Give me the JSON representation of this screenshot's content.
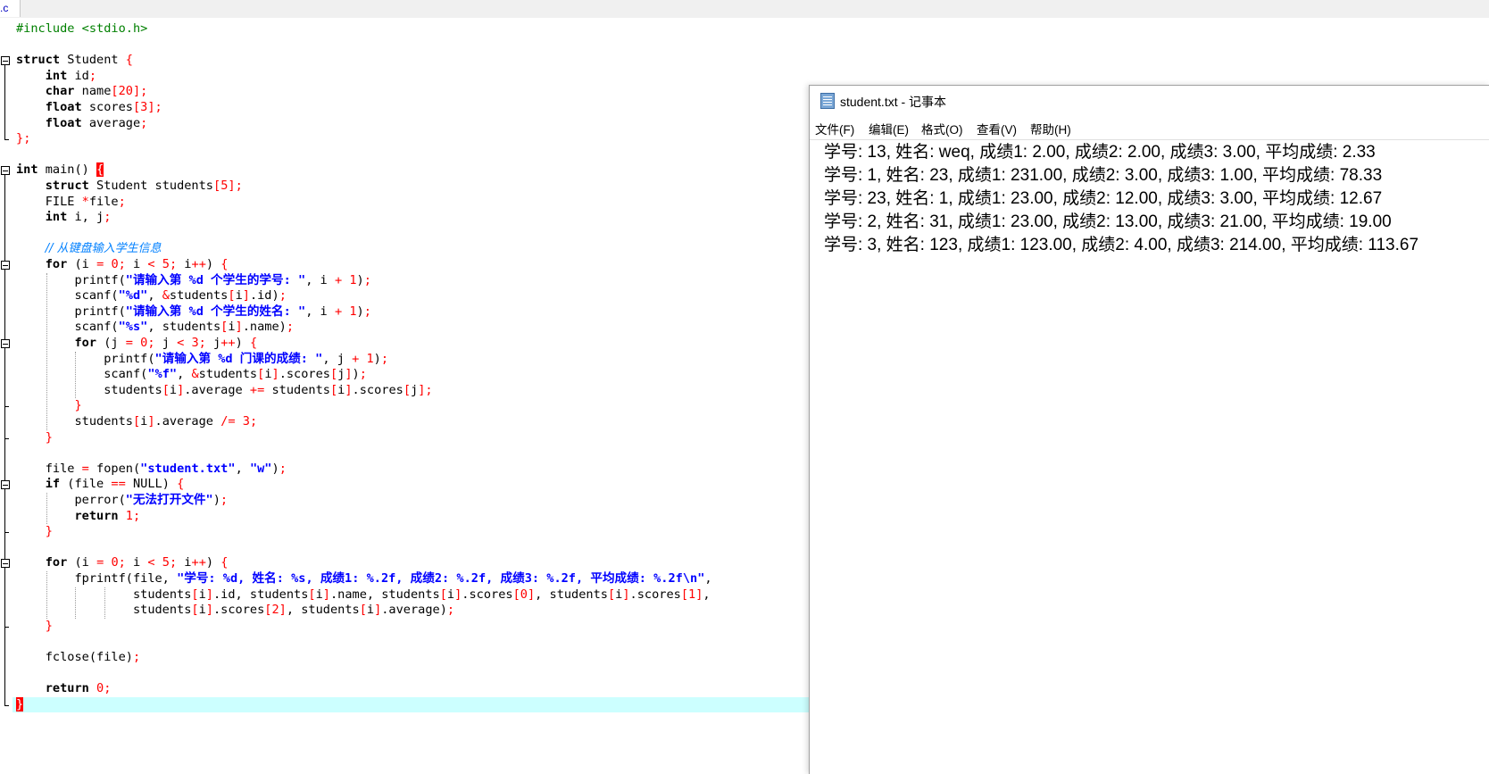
{
  "editor": {
    "tab_label": ".c",
    "lines": [
      "#include <stdio.h>",
      "",
      "struct Student {",
      "    int id;",
      "    char name[20];",
      "    float scores[3];",
      "    float average;",
      "};",
      "",
      "int main() {",
      "    struct Student students[5];",
      "    FILE *file;",
      "    int i, j;",
      "",
      "    // 从键盘输入学生信息",
      "    for (i = 0; i < 5; i++) {",
      "        printf(\"请输入第 %d 个学生的学号: \", i + 1);",
      "        scanf(\"%d\", &students[i].id);",
      "        printf(\"请输入第 %d 个学生的姓名: \", i + 1);",
      "        scanf(\"%s\", students[i].name);",
      "        for (j = 0; j < 3; j++) {",
      "            printf(\"请输入第 %d 门课的成绩: \", j + 1);",
      "            scanf(\"%f\", &students[i].scores[j]);",
      "            students[i].average += students[i].scores[j];",
      "        }",
      "        students[i].average /= 3;",
      "    }",
      "",
      "    file = fopen(\"student.txt\", \"w\");",
      "    if (file == NULL) {",
      "        perror(\"无法打开文件\");",
      "        return 1;",
      "    }",
      "",
      "    for (i = 0; i < 5; i++) {",
      "        fprintf(file, \"学号: %d, 姓名: %s, 成绩1: %.2f, 成绩2: %.2f, 成绩3: %.2f, 平均成绩: %.2f\\n\",",
      "                students[i].id, students[i].name, students[i].scores[0], students[i].scores[1],",
      "                students[i].scores[2], students[i].average);",
      "    }",
      "",
      "    fclose(file);",
      "",
      "    return 0;",
      "}"
    ]
  },
  "notepad": {
    "title": "student.txt - 记事本",
    "menu": [
      "文件(F)",
      "编辑(E)",
      "格式(O)",
      "查看(V)",
      "帮助(H)"
    ],
    "lines": [
      "学号: 13, 姓名: weq, 成绩1: 2.00, 成绩2: 2.00, 成绩3: 3.00, 平均成绩: 2.33",
      "学号: 1, 姓名: 23, 成绩1: 231.00, 成绩2: 3.00, 成绩3: 1.00, 平均成绩: 78.33",
      "学号: 23, 姓名: 1, 成绩1: 23.00, 成绩2: 12.00, 成绩3: 3.00, 平均成绩: 12.67",
      "学号: 2, 姓名: 31, 成绩1: 23.00, 成绩2: 13.00, 成绩3: 21.00, 平均成绩: 19.00",
      "学号: 3, 姓名: 123, 成绩1: 123.00, 成绩2: 4.00, 成绩3: 214.00, 平均成绩: 113.67"
    ]
  },
  "colors": {
    "keyword": "#000000",
    "operator": "#ff0000",
    "string": "#0000ff",
    "comment": "#0080ff",
    "preprocessor": "#008000",
    "current_line": "#ccffff"
  }
}
